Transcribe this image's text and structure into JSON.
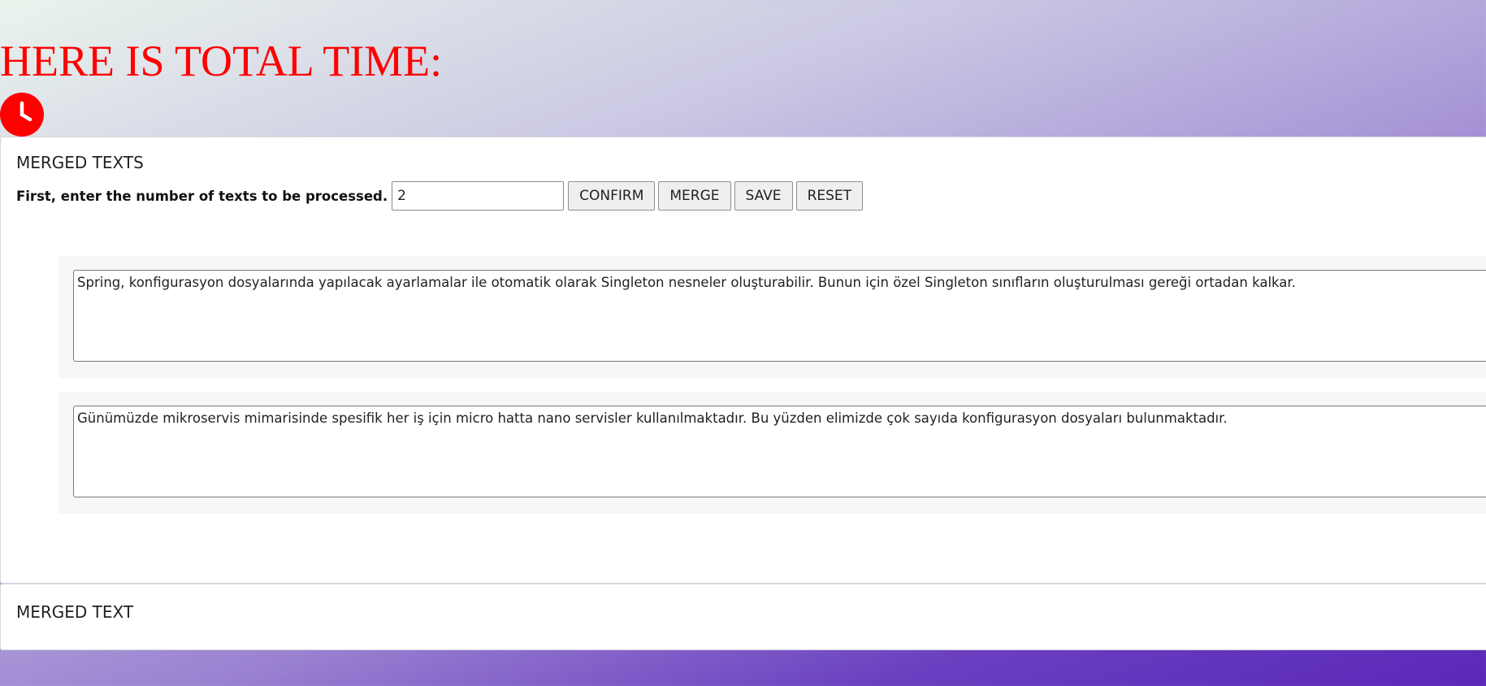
{
  "header": {
    "title": "HERE IS TOTAL TIME:",
    "clock_icon": "clock-icon",
    "clock_color": "#ff0000"
  },
  "merged_texts_panel": {
    "heading": "MERGED TEXTS",
    "prompt_label": "First, enter the number of texts to be processed.",
    "count_input_value": "2",
    "buttons": {
      "confirm": "CONFIRM",
      "merge": "MERGE",
      "save": "SAVE",
      "reset": "RESET"
    },
    "texts": [
      "Spring, konfigurasyon dosyalarında yapılacak ayarlamalar ile otomatik olarak Singleton nesneler oluşturabilir. Bunun için özel Singleton sınıfların oluşturulması gereği ortadan kalkar.",
      "Günümüzde mikroservis mimarisinde spesifik her iş için micro hatta nano servisler kullanılmaktadır. Bu yüzden elimizde çok sayıda konfigurasyon dosyaları bulunmaktadır."
    ]
  },
  "merged_text_panel": {
    "heading": "MERGED TEXT"
  }
}
